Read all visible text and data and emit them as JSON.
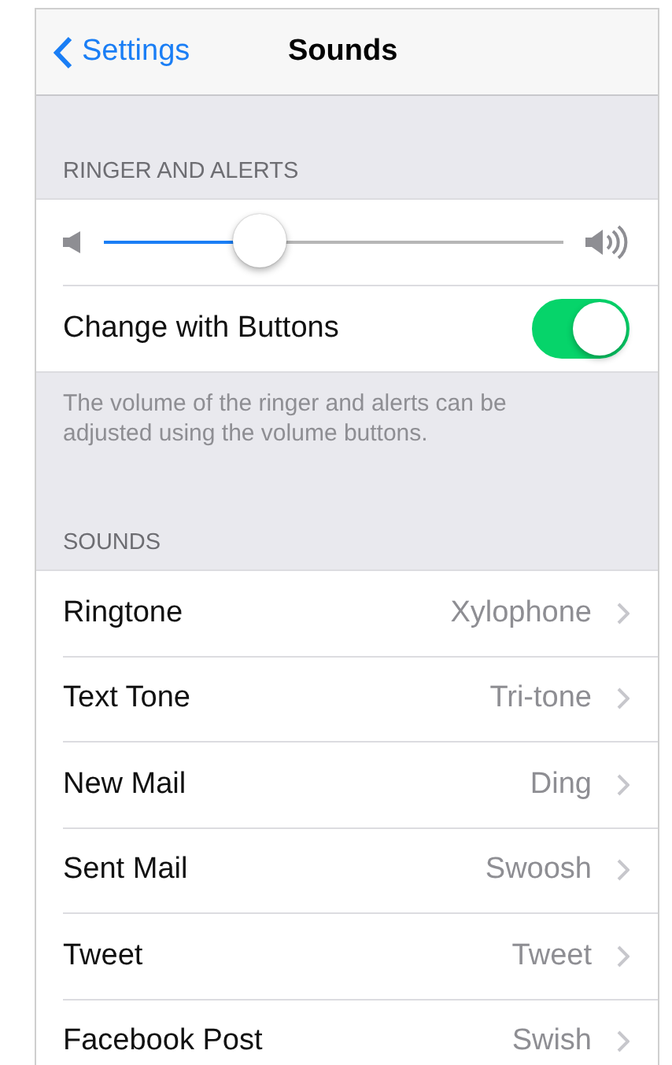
{
  "nav": {
    "back": "Settings",
    "title": "Sounds"
  },
  "ringer_section": {
    "header": "RINGER AND ALERTS",
    "volume": {
      "level": 0.34
    },
    "toggle": {
      "label": "Change with Buttons",
      "on": true
    },
    "footer": "The volume of the ringer and alerts can be adjusted using the volume buttons."
  },
  "sounds_section": {
    "header": "SOUNDS",
    "rows": [
      {
        "label": "Ringtone",
        "value": "Xylophone"
      },
      {
        "label": "Text Tone",
        "value": "Tri-tone"
      },
      {
        "label": "New Mail",
        "value": "Ding"
      },
      {
        "label": "Sent Mail",
        "value": "Swoosh"
      },
      {
        "label": "Tweet",
        "value": "Tweet"
      },
      {
        "label": "Facebook Post",
        "value": "Swish"
      }
    ]
  }
}
